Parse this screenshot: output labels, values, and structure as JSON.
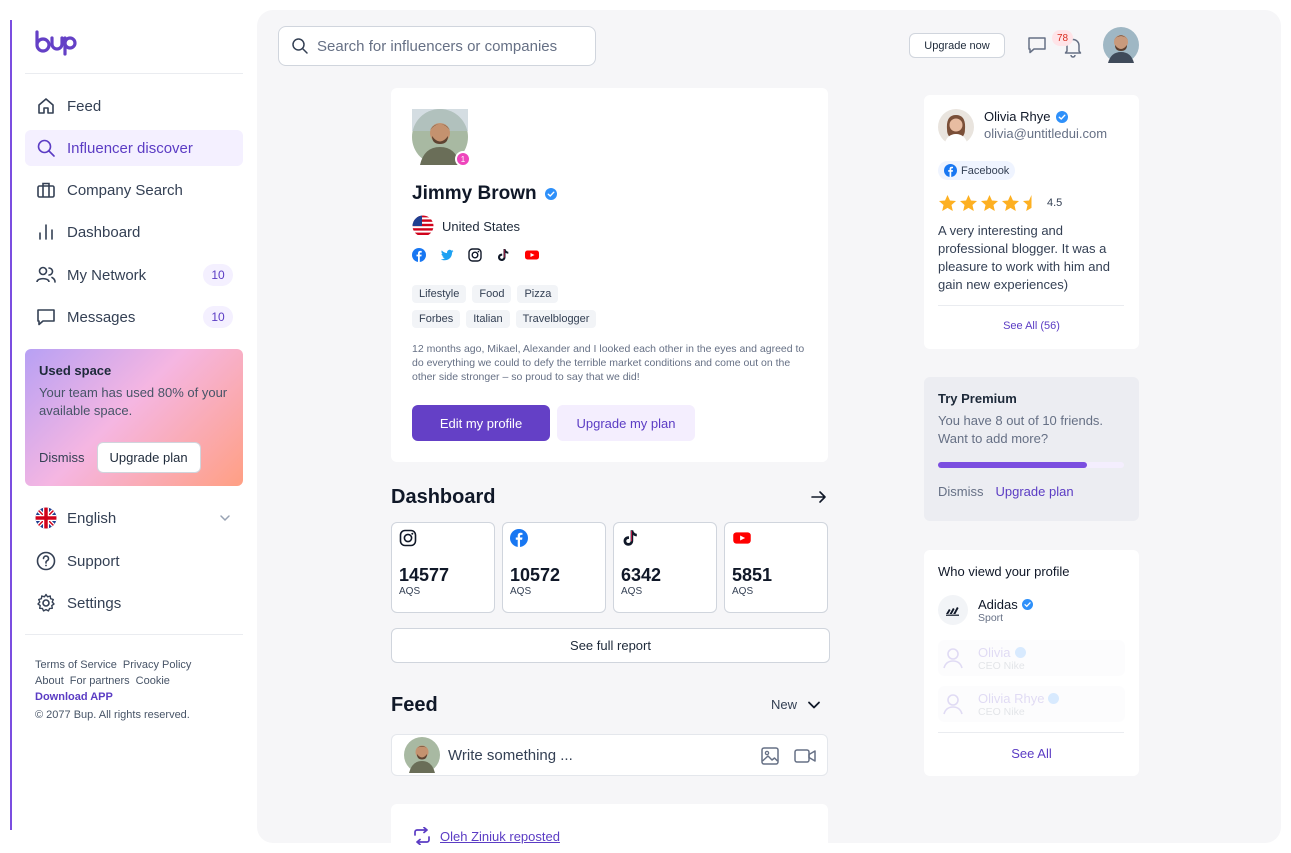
{
  "app": {
    "logo_text": "bup"
  },
  "sidebar": {
    "nav": [
      {
        "label": "Feed"
      },
      {
        "label": "Influencer discover"
      },
      {
        "label": "Company Search"
      },
      {
        "label": "Dashboard"
      },
      {
        "label": "My Network",
        "badge": "10"
      },
      {
        "label": "Messages",
        "badge": "10"
      }
    ],
    "space_card": {
      "title": "Used space",
      "text": "Your team has used 80% of your available space.",
      "dismiss": "Dismiss",
      "upgrade": "Upgrade plan"
    },
    "language": "English",
    "support": "Support",
    "settings": "Settings",
    "footer": {
      "terms": "Terms of Service",
      "privacy": "Privacy Policy",
      "about": "About",
      "partners": "For partners",
      "cookie": "Cookie",
      "download": "Download APP",
      "copyright": "© 2077 Bup. All rights reserved."
    }
  },
  "header": {
    "search_placeholder": "Search for influencers or companies",
    "upgrade_now": "Upgrade now",
    "notification_count": "78"
  },
  "profile": {
    "avatar_badge": "1",
    "name": "Jimmy Brown",
    "country": "United States",
    "tags_row1": [
      "Lifestyle",
      "Food",
      "Pizza"
    ],
    "tags_row2": [
      "Forbes",
      "Italian",
      "Travelblogger"
    ],
    "description": "12 months ago, Mikael, Alexander and I looked each other in the eyes and agreed to do everything we could to defy the terrible market conditions and come out on the other side stronger – so proud to say that we did!",
    "edit_button": "Edit my profile",
    "upgrade_button": "Upgrade my plan"
  },
  "dashboard": {
    "title": "Dashboard",
    "stats": [
      {
        "platform": "instagram",
        "value": "14577",
        "label": "AQS"
      },
      {
        "platform": "facebook",
        "value": "10572",
        "label": "AQS"
      },
      {
        "platform": "tiktok",
        "value": "6342",
        "label": "AQS"
      },
      {
        "platform": "youtube",
        "value": "5851",
        "label": "AQS"
      }
    ],
    "full_report": "See full report"
  },
  "feed": {
    "title": "Feed",
    "sort": "New",
    "write_placeholder": "Write something ...",
    "repost_text": "Oleh Ziniuk reposted"
  },
  "review": {
    "name": "Olivia Rhye",
    "email": "olivia@untitledui.com",
    "platform": "Facebook",
    "rating": "4.5",
    "rating_value": 4.5,
    "text": "A very interesting and professional blogger. It was a pleasure to work with him and gain new experiences)",
    "see_all": "See All (56)"
  },
  "premium": {
    "title": "Try Premium",
    "text": "You have 8 out of 10 friends. Want to add more?",
    "progress": 0.8,
    "dismiss": "Dismiss",
    "upgrade": "Upgrade plan"
  },
  "viewers": {
    "title": "Who viewd your profile",
    "items": [
      {
        "name": "Adidas",
        "sub": "Sport"
      },
      {
        "name": "Olivia",
        "sub": "CEO Nike"
      },
      {
        "name": "Olivia Rhye",
        "sub": "CEO Nike"
      }
    ],
    "see_all": "See All"
  },
  "colors": {
    "accent": "#6440c6",
    "accent_light": "#f4eefe",
    "facebook": "#1877f2",
    "twitter": "#1da1f2",
    "youtube": "#ff0000",
    "star": "#fdb022"
  }
}
